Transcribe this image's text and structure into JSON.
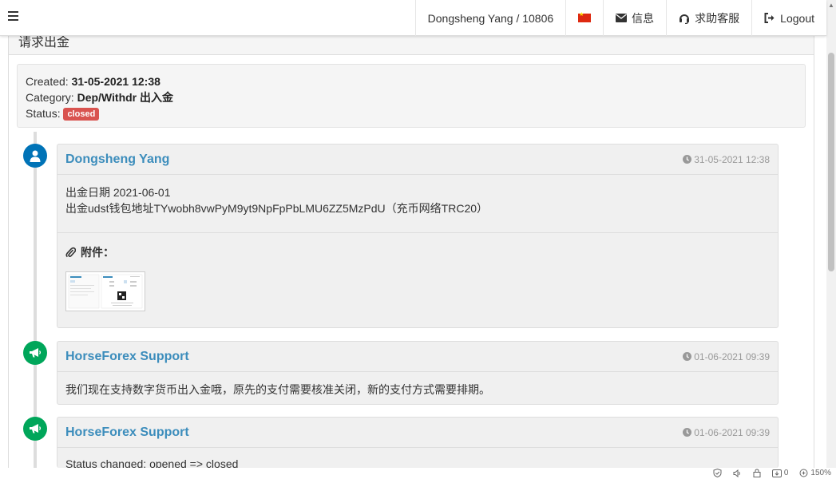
{
  "navbar": {
    "user": "Dongsheng Yang / 10806",
    "messages": "信息",
    "support": "求助客服",
    "logout": "Logout"
  },
  "panel": {
    "title": "请求出金"
  },
  "ticket": {
    "created_label": "Created: ",
    "created_value": "31-05-2021 12:38",
    "category_label": "Category: ",
    "category_value": "Dep/Withdr 出入金",
    "status_label": "Status: ",
    "status_value": "closed"
  },
  "entries": [
    {
      "author": "Dongsheng Yang",
      "time": "31-05-2021 12:38",
      "line1": "出金日期 2021-06-01",
      "line2": "出金udst钱包地址TYwobh8vwPyM9yt9NpFpPbLMU6ZZ5MzPdU（充币网络TRC20）",
      "attachments_label": "附件："
    },
    {
      "author": "HorseForex Support",
      "time": "01-06-2021 09:39",
      "line1": "我们现在支持数字货币出入金哦，原先的支付需要核准关闭，新的支付方式需要排期。"
    },
    {
      "author": "HorseForex Support",
      "time": "01-06-2021 09:39",
      "line1": "Status changed: opened => closed"
    }
  ],
  "statusbar": {
    "count": "0",
    "zoom": "150%"
  },
  "colors": {
    "link": "#3c8dbc",
    "closed_badge": "#d9534f",
    "user_icon": "#0073b7",
    "support_icon": "#00a65a"
  }
}
